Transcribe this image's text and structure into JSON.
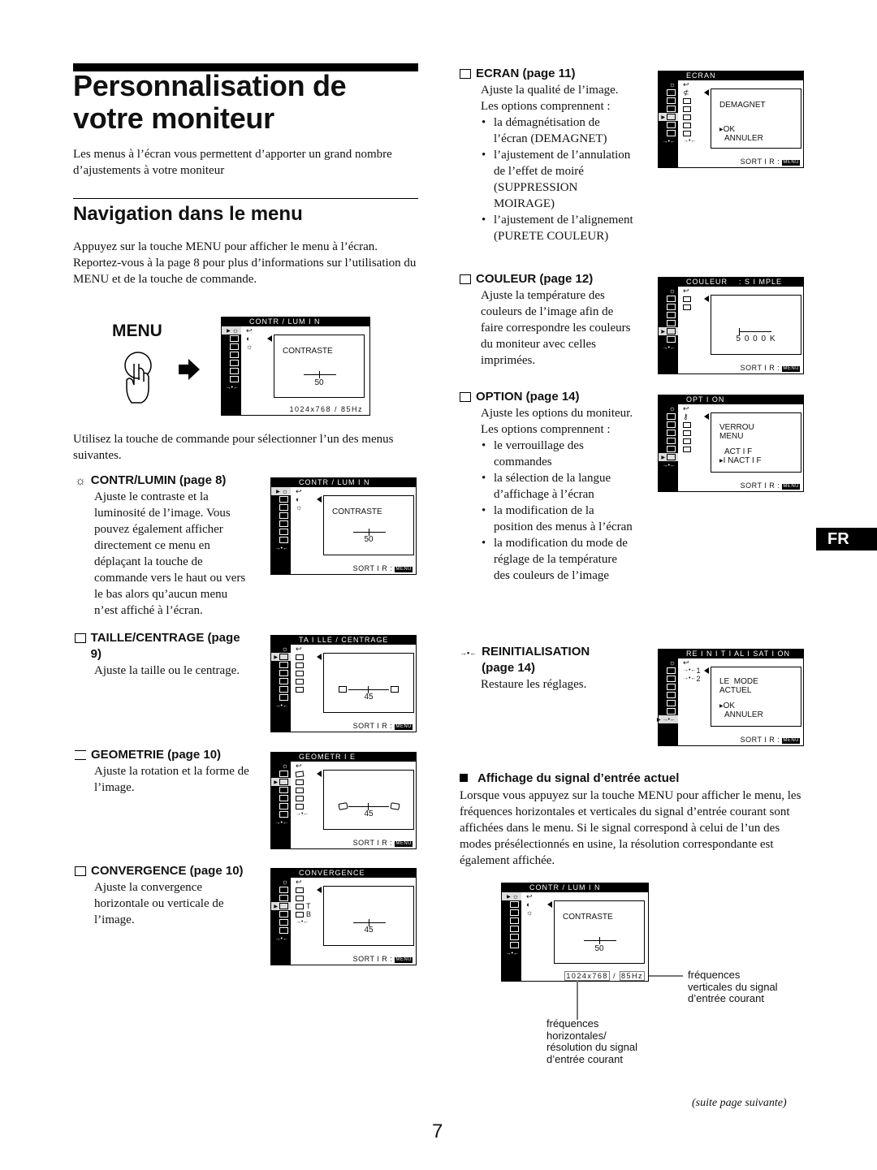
{
  "page": {
    "title": "Personnalisation de votre moniteur",
    "intro": "Les menus à l’écran vous permettent d’apporter un grand nombre d’ajustements à votre moniteur",
    "section_title": "Navigation dans le menu",
    "nav_para": "Appuyez sur la touche MENU pour afficher le menu à l’écran. Reportez-vous à la page 8 pour plus d’informations sur l’utilisation du MENU et de la touche de commande.",
    "menu_label": "MENU",
    "select_para": "Utilisez la touche de commande pour sélectionner l’un des menus suivantes.",
    "language_tab": "FR",
    "page_number": "7",
    "continued": "(suite page suivante)"
  },
  "intro_osd": {
    "title": "CONTR / LUM I N",
    "panel_label": "CONTRASTE",
    "value": "50",
    "footer": "1024x768 /  85Hz"
  },
  "sections": [
    {
      "icon": "brightness-icon",
      "title": "CONTR/LUMIN (page 8)",
      "body": "Ajuste le contraste et la luminosité de l’image. Vous pouvez également afficher directement ce menu en déplaçant la touche de commande vers le haut ou vers le bas alors qu’aucun menu n’est affiché à l’écran.",
      "osd": {
        "title": "CONTR / LUM I N",
        "panel": "CONTRASTE",
        "value": "50",
        "footer": "SORT I R :",
        "key": "MENU"
      }
    },
    {
      "icon": "size-center-icon",
      "title": "TAILLE/CENTRAGE (page 9)",
      "body": "Ajuste la taille ou le centrage.",
      "osd": {
        "title": "TA I LLE / CENTRAGE",
        "panel": "",
        "value": "45",
        "footer": "SORT I R :",
        "key": "MENU"
      }
    },
    {
      "icon": "geometry-icon",
      "title": "GEOMETRIE (page 10)",
      "body": "Ajuste la rotation et la forme de l’image.",
      "osd": {
        "title": "GEOMETR I E",
        "panel": "",
        "value": "45",
        "footer": "SORT I R :",
        "key": "MENU"
      }
    },
    {
      "icon": "convergence-icon",
      "title": "CONVERGENCE (page 10)",
      "body": "Ajuste la convergence horizontale ou verticale de l’image.",
      "osd": {
        "title": "CONVERGENCE",
        "panel": "",
        "value": "45",
        "footer": "SORT I R :",
        "key": "MENU",
        "sub_t": "T",
        "sub_b": "B"
      }
    },
    {
      "icon": "screen-icon",
      "title": "ECRAN (page 11)",
      "body": "Ajuste la qualité de l’image. Les options comprennent :",
      "bullets": [
        "la démagnétisation de l’écran (DEMAGNET)",
        "l’ajustement de l’annulation de l’effet de moiré (SUPPRESSION MOIRAGE)",
        "l’ajustement de l’alignement (PURETE COULEUR)"
      ],
      "osd": {
        "title": "ECRAN",
        "panel": "DEMAGNET",
        "opt1": "OK",
        "opt2": "ANNULER",
        "footer": "SORT I R :",
        "key": "MENU"
      }
    },
    {
      "icon": "color-icon",
      "title": "COULEUR (page 12)",
      "body": "Ajuste la température des couleurs de l’image afin de faire correspondre les couleurs du moniteur avec celles imprimées.",
      "osd": {
        "title": "COULEUR    : S I MPLE",
        "value": "5 0 0 0 K",
        "footer": "SORT I R :",
        "key": "MENU"
      }
    },
    {
      "icon": "option-icon",
      "title": "OPTION (page 14)",
      "body": "Ajuste les options du moniteur.",
      "body2": "Les options comprennent :",
      "bullets": [
        "le verrouillage des commandes",
        "la sélection de la langue d’affichage à l’écran",
        "la modification de la position des menus à l’écran",
        "la modification du mode de réglage de la température des couleurs de l’image"
      ],
      "osd": {
        "title": "OPT I ON",
        "panel": "VERROU",
        "panel2": "MENU",
        "opt1": "ACT I F",
        "opt2": "I NACT I F",
        "footer": "SORT I R :",
        "key": "MENU"
      }
    },
    {
      "icon": "reset-icon",
      "title": "REINITIALISATION (page 14)",
      "body": "Restaure les réglages.",
      "osd": {
        "title": "RE I N I T I AL I SAT I ON",
        "sub1": "1",
        "sub2": "2",
        "panel": "LE  MODE",
        "panel2": "ACTUEL",
        "opt1": "OK",
        "opt2": "ANNULER",
        "footer": "SORT I R :",
        "key": "MENU"
      }
    }
  ],
  "signal": {
    "title": "Affichage du signal d’entrée actuel",
    "body": "Lorsque vous appuyez sur la touche MENU pour afficher le menu, les fréquences horizontales et verticales du signal d’entrée courant sont affichées dans le menu. Si le signal correspond à celui de l’un des modes présélectionnés en usine, la résolution correspondante est également affichée.",
    "osd": {
      "title": "CONTR / LUM I N",
      "panel": "CONTRASTE",
      "value": "50",
      "resolution": "1024x768",
      "sep": "/",
      "freq": "85Hz"
    },
    "callout_vertical": "fréquences verticales du signal d’entrée courant",
    "callout_horizontal": "fréquences horizontales/ résolution du signal d’entrée courant"
  }
}
